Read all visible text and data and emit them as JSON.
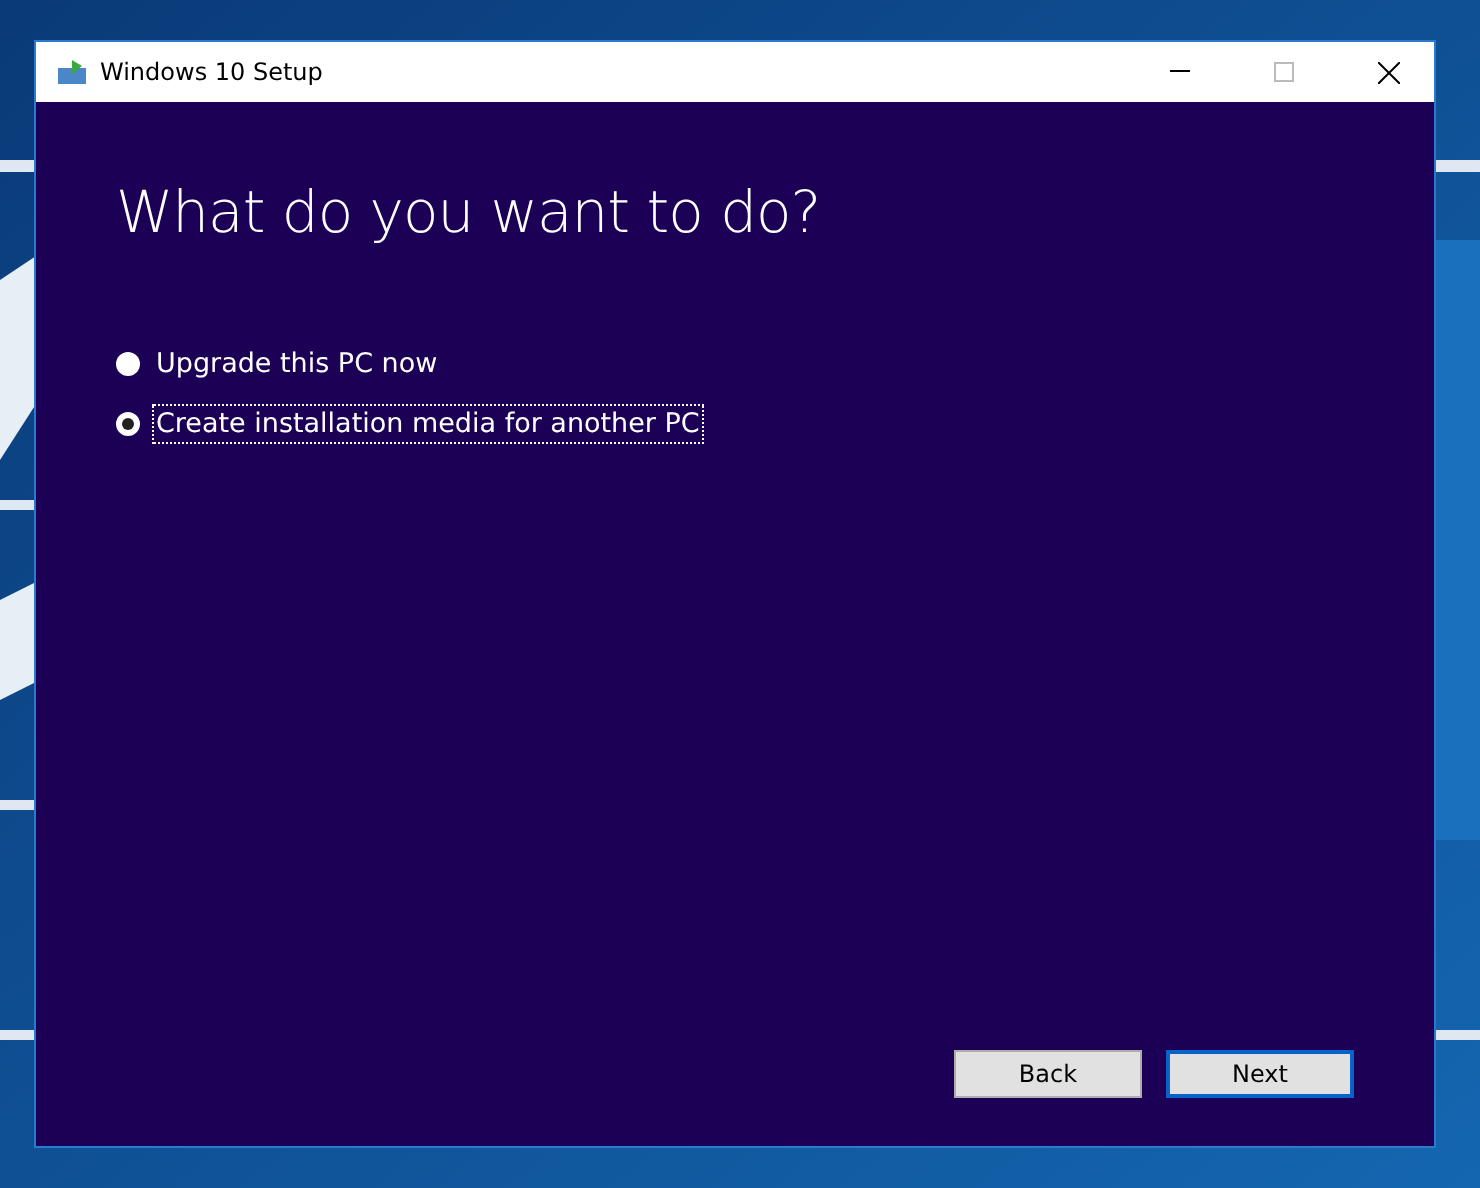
{
  "window": {
    "title": "Windows 10 Setup"
  },
  "heading": "What do you want to do?",
  "options": [
    {
      "label": "Upgrade this PC now",
      "selected": false,
      "focused": false
    },
    {
      "label": "Create installation media for another PC",
      "selected": true,
      "focused": true
    }
  ],
  "buttons": [
    {
      "label": "Back",
      "default": false
    },
    {
      "label": "Next",
      "default": true
    }
  ]
}
